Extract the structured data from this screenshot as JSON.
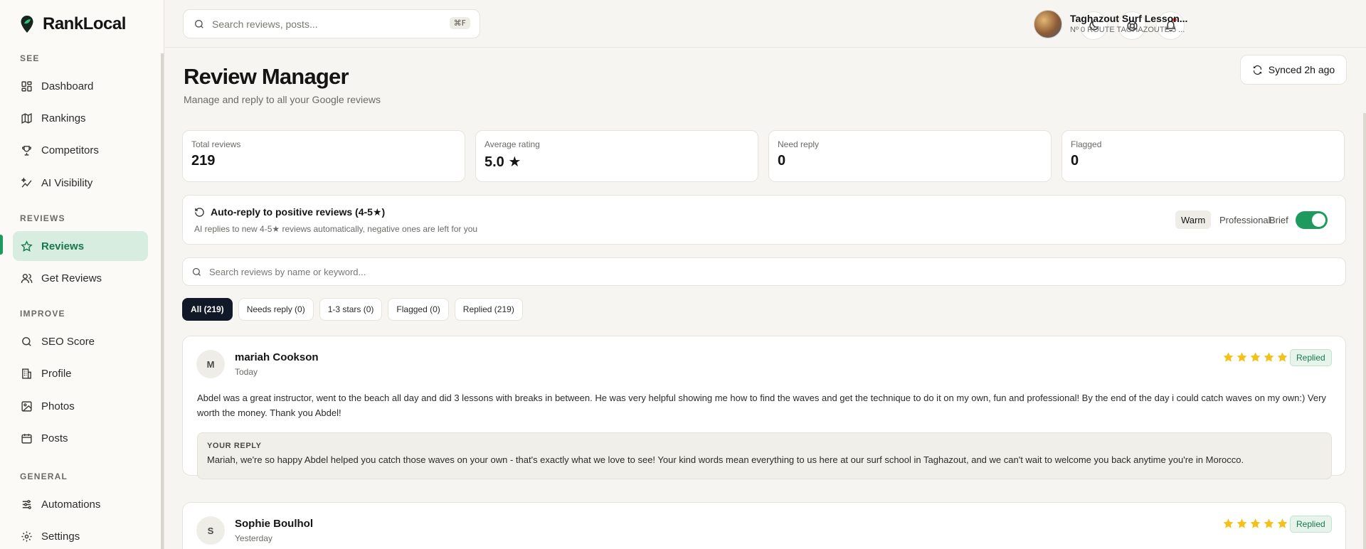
{
  "app": {
    "name": "RankLocal",
    "logo_icon": "map-pin-leaf-icon",
    "brand_color": "#1f9a5f"
  },
  "sidebar": {
    "sections": [
      {
        "title": "SEE",
        "items": [
          {
            "label": "Dashboard",
            "icon": "dashboard-icon"
          },
          {
            "label": "Rankings",
            "icon": "map-icon"
          },
          {
            "label": "Competitors",
            "icon": "trophy-icon"
          },
          {
            "label": "AI Visibility",
            "icon": "sparkle-chart-icon"
          }
        ]
      },
      {
        "title": "REVIEWS",
        "items": [
          {
            "label": "Reviews",
            "icon": "star-icon",
            "active": true
          },
          {
            "label": "Get Reviews",
            "icon": "users-icon"
          }
        ]
      },
      {
        "title": "IMPROVE",
        "items": [
          {
            "label": "SEO Score",
            "icon": "search-icon"
          },
          {
            "label": "Profile",
            "icon": "building-icon"
          },
          {
            "label": "Photos",
            "icon": "image-icon"
          },
          {
            "label": "Posts",
            "icon": "calendar-icon"
          }
        ]
      },
      {
        "title": "GENERAL",
        "items": [
          {
            "label": "Automations",
            "icon": "sliders-icon"
          },
          {
            "label": "Settings",
            "icon": "gear-icon"
          }
        ]
      }
    ]
  },
  "topbar": {
    "search_placeholder": "Search reviews, posts...",
    "search_shortcut": "⌘F",
    "account_name": "Taghazout Surf Lesson...",
    "account_address": "Nº 0 ROUTE TAGHAZOUTE 5 ..."
  },
  "page": {
    "title": "Review Manager",
    "subtitle": "Manage and reply to all your Google reviews",
    "sync_label": "Synced 2h ago"
  },
  "stats": [
    {
      "label": "Total reviews",
      "value": "219"
    },
    {
      "label": "Average rating",
      "value": "5.0 ★"
    },
    {
      "label": "Need reply",
      "value": "0"
    },
    {
      "label": "Flagged",
      "value": "0"
    }
  ],
  "auto_reply": {
    "title": "Auto-reply to positive reviews (4-5★)",
    "subtitle": "AI replies to new 4-5★ reviews automatically, negative ones are left for you",
    "tones": [
      "Warm",
      "Professional",
      "Brief"
    ],
    "selected_tone": "Warm",
    "enabled": true
  },
  "review_search": {
    "placeholder": "Search reviews by name or keyword..."
  },
  "filters": [
    "All (219)",
    "Needs reply (0)",
    "1-3 stars (0)",
    "Flagged (0)",
    "Replied (219)"
  ],
  "reviews": [
    {
      "initial": "M",
      "name": "mariah Cookson",
      "date": "Today",
      "rating": 5,
      "status": "Replied",
      "text": "Abdel was a great instructor, went to the beach all day and did 3 lessons with breaks in between. He was very helpful showing me how to find the waves and get the technique to do it on my own, fun and professional! By the end of the day i could catch waves on my own:) Very worth the money. Thank you Abdel!",
      "reply_label": "YOUR REPLY",
      "reply": "Mariah, we're so happy Abdel helped you catch those waves on your own - that's exactly what we love to see! Your kind words mean everything to us here at our surf school in Taghazout, and we can't wait to welcome you back anytime you're in Morocco."
    },
    {
      "initial": "S",
      "name": "Sophie Boulhol",
      "date": "Yesterday",
      "rating": 5,
      "status": "Replied"
    }
  ]
}
